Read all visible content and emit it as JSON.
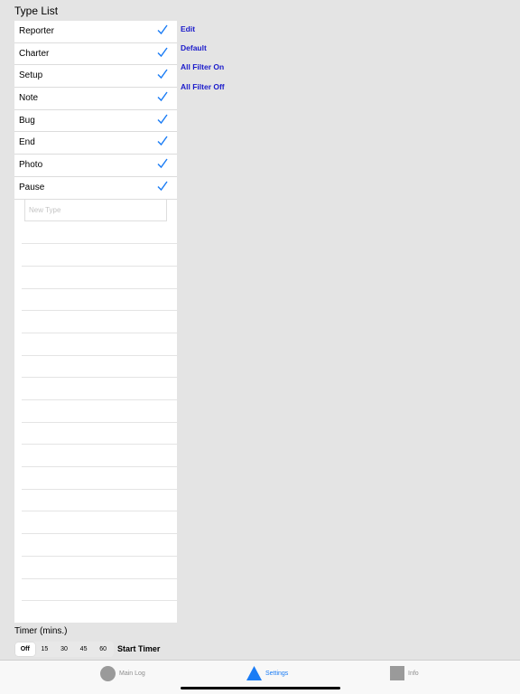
{
  "section_title": "Type List",
  "types": [
    {
      "label": "Reporter",
      "checked": true
    },
    {
      "label": "Charter",
      "checked": true
    },
    {
      "label": "Setup",
      "checked": true
    },
    {
      "label": "Note",
      "checked": true
    },
    {
      "label": "Bug",
      "checked": true
    },
    {
      "label": "End",
      "checked": true
    },
    {
      "label": "Photo",
      "checked": true
    },
    {
      "label": "Pause",
      "checked": true
    }
  ],
  "new_type": {
    "placeholder": "New Type",
    "value": ""
  },
  "actions": {
    "edit": "Edit",
    "default": "Default",
    "all_filter_on": "All Filter On",
    "all_filter_off": "All Filter Off"
  },
  "timer": {
    "label": "Timer (mins.)",
    "options": [
      "Off",
      "15",
      "30",
      "45",
      "60"
    ],
    "selected": "Off",
    "start_label": "Start Timer"
  },
  "tabs": [
    {
      "label": "Main Log",
      "icon": "circle-icon",
      "active": false
    },
    {
      "label": "Settings",
      "icon": "triangle-icon",
      "active": true
    },
    {
      "label": "Info",
      "icon": "square-icon",
      "active": false
    }
  ],
  "colors": {
    "accent": "#1a7cf5",
    "link": "#1a1acb",
    "background": "#e4e4e4",
    "inactive_icon": "#9a9a9a"
  }
}
